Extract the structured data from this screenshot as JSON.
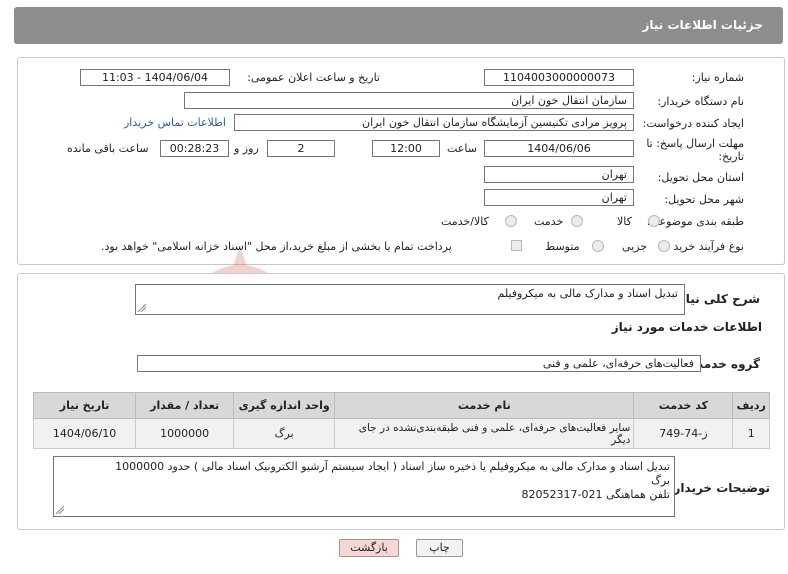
{
  "header": {
    "title": "جزئیات اطلاعات نیاز"
  },
  "need_number": {
    "label": "شماره نیاز:",
    "value": "1104003000000073"
  },
  "announce_date": {
    "label": "تاریخ و ساعت اعلان عمومی:",
    "value": "1404/06/04 - 11:03"
  },
  "buyer_org": {
    "label": "نام دستگاه خریدار:",
    "value": "سازمان انتقال خون ایران"
  },
  "creator": {
    "label": "ایجاد کننده درخواست:",
    "value": "پرویز مرادی تکنیسین آزمایشگاه سازمان انتقال خون ایران",
    "contact_link": "اطلاعات تماس خریدار"
  },
  "deadline": {
    "label_line1": "مهلت ارسال پاسخ: تا",
    "label_line2": "تاریخ:",
    "date": "1404/06/06",
    "time_label": "ساعت",
    "time": "12:00",
    "days": "2",
    "days_label": "روز و",
    "remaining": "00:28:23",
    "remaining_label": "ساعت باقی مانده"
  },
  "province": {
    "label": "استان محل تحویل:",
    "value": "تهران"
  },
  "city": {
    "label": "شهر محل تحویل:",
    "value": "تهران"
  },
  "category": {
    "label": "طبقه بندی موضوعی:",
    "options": [
      "کالا",
      "خدمت",
      "کالا/خدمت"
    ]
  },
  "process": {
    "label": "نوع فرآیند خرید :",
    "options": [
      "جزیی",
      "متوسط"
    ],
    "payment_note": "پرداخت تمام یا بخشی از مبلغ خرید،از محل \"اسناد خزانه اسلامی\" خواهد بود."
  },
  "summary": {
    "label": "شرح کلی نیاز:",
    "value": "تبدیل اسناد و مدارک مالی به میکروفیلم"
  },
  "services_title": "اطلاعات خدمات مورد نیاز",
  "service_group": {
    "label": "گروه خدمت:",
    "value": "فعالیت‌های حرفه‌ای، علمی و فنی"
  },
  "table": {
    "headers": [
      "ردیف",
      "کد خدمت",
      "نام خدمت",
      "واحد اندازه گیری",
      "تعداد / مقدار",
      "تاریخ نیاز"
    ],
    "rows": [
      {
        "row": "1",
        "code": "ز-74-749",
        "name": "سایر فعالیت‌های حرفه‌ای، علمی و فنی طبقه‌بندی‌نشده در جای دیگر",
        "unit": "برگ",
        "qty": "1000000",
        "date": "1404/06/10"
      }
    ]
  },
  "buyer_notes": {
    "label": "توضیحات خریدار:",
    "line1": "تبدیل اسناد و مدارک مالی به میکروفیلم یا ذخیره ساز اسناد ( ایجاد سیستم آرشیو الکترونیک اسناد مالی ) حدود 1000000",
    "line2": "برگ",
    "line3": "تلفن هماهنگی 021-82052317"
  },
  "buttons": {
    "print": "چاپ",
    "back": "بازگشت"
  },
  "watermark": "AriaTender.neT",
  "colors": {
    "header_bg": "#8d8d8d",
    "link": "#2a5ea8",
    "back_button": "#f7d6d6",
    "watermark": "#c0392b"
  }
}
